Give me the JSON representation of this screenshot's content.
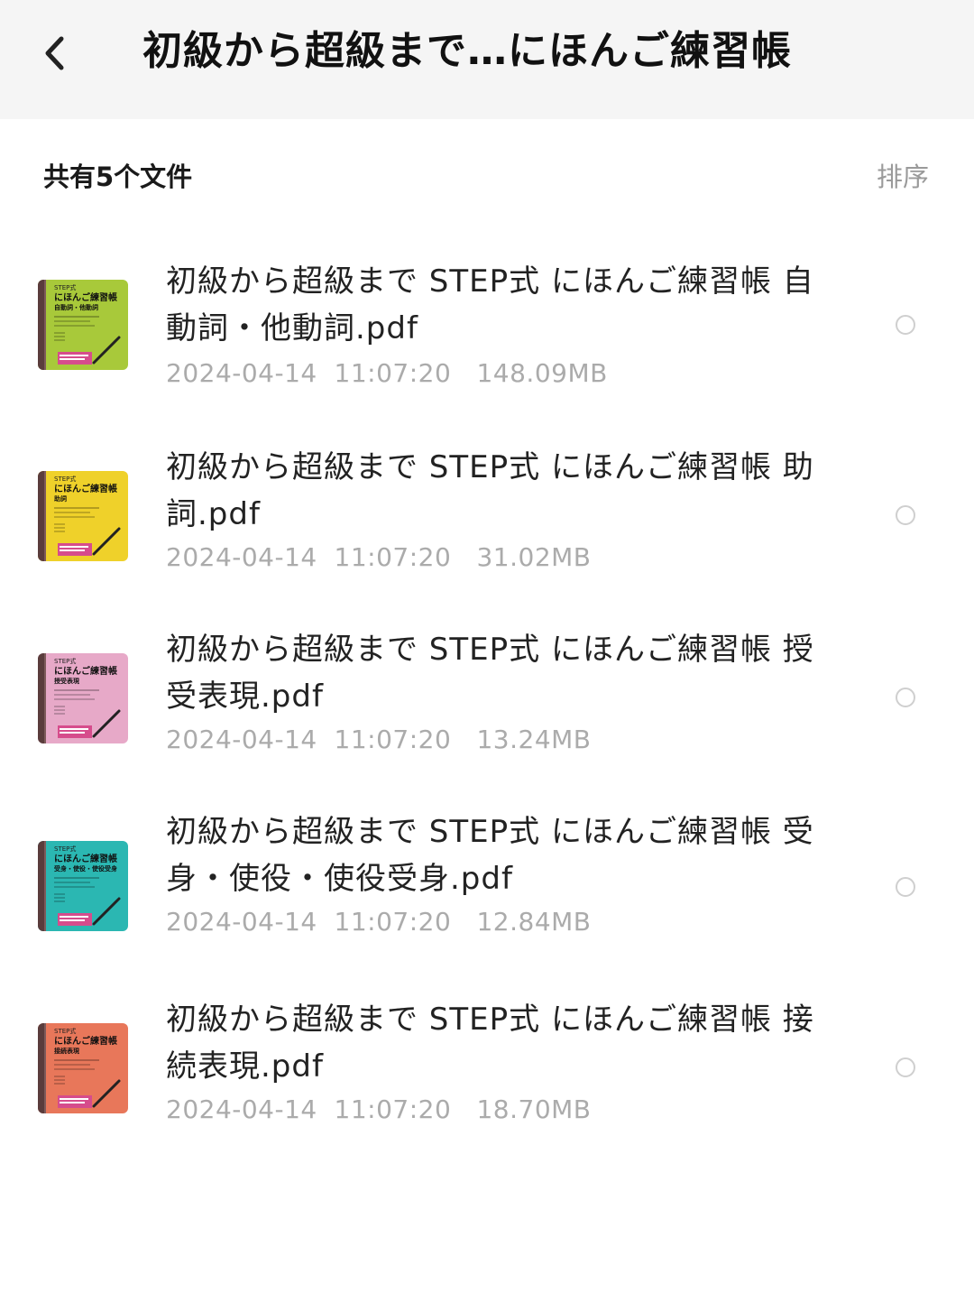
{
  "header": {
    "title": "初級から超級まで…にほんご練習帳",
    "back_icon": "chevron-left-icon"
  },
  "summary": {
    "count_label": "共有5个文件",
    "sort_label": "排序"
  },
  "files": [
    {
      "name": "初級から超級まで STEP式 にほんご練習帳 自動詞・他動詞.pdf",
      "date": "2024-04-14  11:07:20",
      "size": "148.09MB",
      "cover": {
        "color": "#a8c93a",
        "badge": "STEP式",
        "title": "にほんご練習帳",
        "subtitle": "自動詞・他動詞"
      }
    },
    {
      "name": "初級から超級まで STEP式 にほんご練習帳 助詞.pdf",
      "date": "2024-04-14  11:07:20",
      "size": "31.02MB",
      "cover": {
        "color": "#efd12a",
        "badge": "STEP式",
        "title": "にほんご練習帳",
        "subtitle": "助詞"
      }
    },
    {
      "name": "初級から超級まで STEP式 にほんご練習帳 授受表現.pdf",
      "date": "2024-04-14  11:07:20",
      "size": "13.24MB",
      "cover": {
        "color": "#e7a9c8",
        "badge": "STEP式",
        "title": "にほんご練習帳",
        "subtitle": "授受表現"
      }
    },
    {
      "name": "初級から超級まで STEP式 にほんご練習帳 受身・使役・使役受身.pdf",
      "date": "2024-04-14  11:07:20",
      "size": "12.84MB",
      "cover": {
        "color": "#2bb7b2",
        "badge": "STEP式",
        "title": "にほんご練習帳",
        "subtitle": "受身・使役・使役受身"
      }
    },
    {
      "name": "初級から超級まで STEP式 にほんご練習帳 接続表現.pdf",
      "date": "2024-04-14  11:07:20",
      "size": "18.70MB",
      "cover": {
        "color": "#e8775a",
        "badge": "STEP式",
        "title": "にほんご練習帳",
        "subtitle": "接続表現"
      }
    }
  ]
}
